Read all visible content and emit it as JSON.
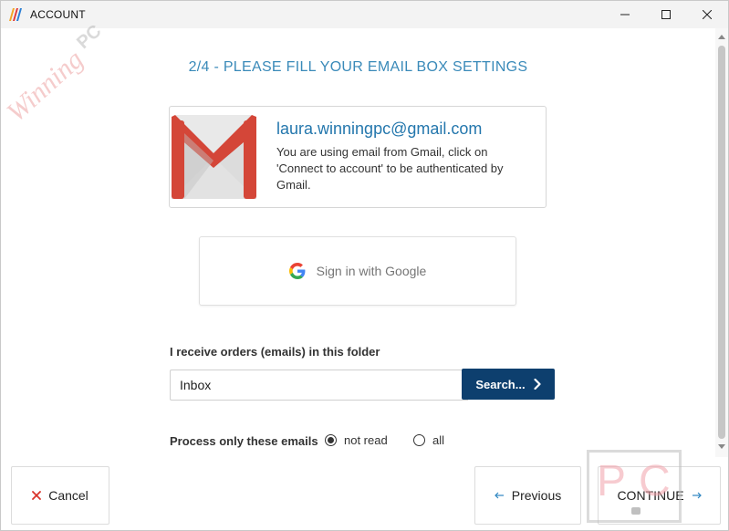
{
  "window": {
    "title": "ACCOUNT"
  },
  "step": {
    "title": "2/4 - PLEASE FILL YOUR EMAIL BOX SETTINGS"
  },
  "account_card": {
    "email": "laura.winningpc@gmail.com",
    "description": "You are using email from Gmail, click on 'Connect to account' to be authenticated by Gmail."
  },
  "google_signin": {
    "label": "Sign in with Google"
  },
  "folder": {
    "label": "I receive orders (emails) in this folder",
    "value": "Inbox",
    "search_label": "Search..."
  },
  "process": {
    "label": "Process only these emails",
    "options": [
      {
        "label": "not read",
        "selected": true
      },
      {
        "label": "all",
        "selected": false
      }
    ]
  },
  "footer": {
    "cancel_label": "Cancel",
    "previous_label": "Previous",
    "continue_label": "CONTINUE"
  },
  "watermark": {
    "left_script": "Winning",
    "left_block": "PC",
    "right_p": "P",
    "right_c": "C"
  },
  "colors": {
    "accent_title": "#3a8ab9",
    "email_link": "#2477ad",
    "search_button": "#0d3f6e",
    "cancel_icon": "#d9342b",
    "arrow_icon": "#2e86c1"
  },
  "icons": {
    "app": "app-logo-icon",
    "gmail": "gmail-logo-icon",
    "google": "google-g-icon",
    "search_chevron": "chevron-right-icon",
    "cancel": "close-icon",
    "previous": "arrow-left-icon",
    "continue": "arrow-right-icon"
  }
}
